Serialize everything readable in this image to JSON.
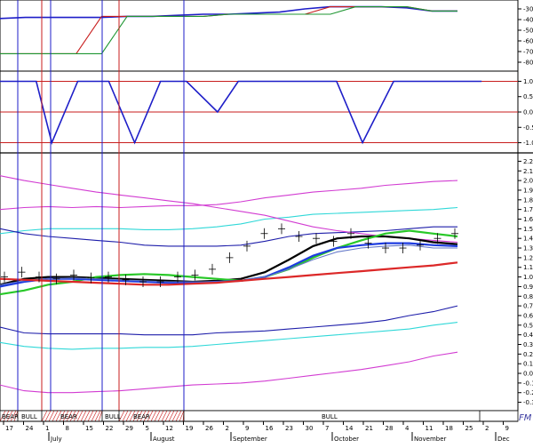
{
  "chart_data": [
    {
      "type": "line",
      "panel": "top-oscillator",
      "y_ticks": [
        "-30",
        "-40",
        "-50",
        "-60",
        "-70",
        "-80"
      ],
      "ylim": [
        -85,
        -25
      ],
      "x": [
        0,
        5,
        10,
        15,
        20,
        25,
        30,
        35,
        40,
        45,
        50,
        55,
        60,
        65,
        70,
        75,
        80,
        85,
        90
      ],
      "series": [
        {
          "color": "#1e1ec8",
          "values": [
            -39,
            -38,
            -38,
            -38,
            -38,
            -37,
            -37,
            -36,
            -35,
            -35,
            -34,
            -33,
            -30,
            -28,
            -28,
            -28,
            -29,
            -32,
            -32
          ]
        },
        {
          "color": "#c81e1e",
          "values": [
            -72,
            -72,
            -72,
            -72,
            -37,
            -37,
            -37,
            -37,
            -37,
            -35,
            -35,
            -35,
            -35,
            -28,
            -28,
            -28,
            -28,
            -32,
            -32
          ]
        },
        {
          "color": "#1e9632",
          "values": [
            -72,
            -72,
            -72,
            -72,
            -72,
            -37,
            -37,
            -37,
            -37,
            -35,
            -35,
            -35,
            -35,
            -35,
            -28,
            -28,
            -28,
            -32,
            -32
          ]
        }
      ]
    },
    {
      "type": "line",
      "panel": "signal",
      "y_ticks": [
        "1.0",
        "0.5",
        "0.0",
        "-0.5",
        "-1.0"
      ],
      "ylim": [
        -1.1,
        1.1
      ],
      "x": [
        0,
        7,
        10,
        15,
        21,
        26,
        31,
        36,
        42,
        46,
        50,
        53,
        57,
        60,
        65,
        70,
        76,
        80,
        84,
        89,
        93
      ],
      "series": [
        {
          "color": "#1e1ec8",
          "values": [
            1,
            1,
            -1,
            1,
            1,
            -1,
            1,
            1,
            0,
            1,
            1,
            1,
            1,
            1,
            1,
            -1,
            1,
            1,
            1,
            1,
            1
          ]
        }
      ]
    },
    {
      "type": "line",
      "panel": "price",
      "y_ticks": [
        "2.2",
        "2.1",
        "2.0",
        "1.9",
        "1.8",
        "1.7",
        "1.6",
        "1.5",
        "1.4",
        "1.3",
        "1.2",
        "1.1",
        "1.0",
        "0.9",
        "0.8",
        "0.7",
        "0.6",
        "0.5",
        "0.4",
        "0.3",
        "0.2",
        "0.1",
        "0.0",
        "-0.1",
        "-0.2",
        "-0.3"
      ],
      "ylim": [
        -0.35,
        2.25
      ],
      "x_labels": [
        "17",
        "24",
        "1",
        "8",
        "15",
        "22",
        "29",
        "5",
        "12",
        "19",
        "26",
        "2",
        "9",
        "16",
        "23",
        "30",
        "7",
        "14",
        "21",
        "28",
        "4",
        "11",
        "18",
        "25",
        "2",
        "9"
      ],
      "months": [
        "July",
        "August",
        "September",
        "October",
        "November",
        "Dec"
      ],
      "vertical_blue_at": [
        "20",
        "57",
        "115",
        "207"
      ],
      "vertical_red_at": [
        "47",
        "134"
      ],
      "band_labels": [
        "BEAR",
        "BULL",
        "BEAR",
        "BULL",
        "BEAR",
        "BULL"
      ],
      "series": [
        {
          "name": "",
          "color": "#d23cd2",
          "role": "upper-outer",
          "values": [
            1.7,
            1.72,
            1.73,
            1.72,
            1.73,
            1.72,
            1.73,
            1.74,
            1.74,
            1.75,
            1.78,
            1.82,
            1.85,
            1.88,
            1.9,
            1.92,
            1.95,
            1.97,
            1.99,
            2.0
          ]
        },
        {
          "name": "",
          "color": "#30d8d8",
          "role": "upper-mid",
          "values": [
            1.45,
            1.48,
            1.5,
            1.5,
            1.5,
            1.5,
            1.49,
            1.49,
            1.5,
            1.52,
            1.55,
            1.6,
            1.62,
            1.65,
            1.66,
            1.67,
            1.68,
            1.69,
            1.7,
            1.72
          ]
        },
        {
          "name": "",
          "color": "#1e1eaa",
          "role": "upper-inner",
          "values": [
            1.5,
            1.45,
            1.42,
            1.4,
            1.38,
            1.36,
            1.33,
            1.32,
            1.32,
            1.32,
            1.33,
            1.37,
            1.42,
            1.45,
            1.46,
            1.47,
            1.48,
            1.5,
            1.52,
            1.52
          ]
        },
        {
          "name": "",
          "color": "#d23cd2",
          "role": "trend",
          "values": [
            2.05,
            2.0,
            1.96,
            1.92,
            1.88,
            1.85,
            1.82,
            1.79,
            1.76,
            1.72,
            1.68,
            1.64,
            1.58,
            1.52,
            1.48,
            1.45,
            1.42,
            1.4,
            1.38,
            1.36
          ]
        },
        {
          "name": "",
          "color": "#000000",
          "role": "avg-black",
          "values": [
            0.92,
            0.98,
            1.0,
            1.0,
            0.99,
            0.98,
            0.97,
            0.96,
            0.95,
            0.96,
            0.98,
            1.05,
            1.18,
            1.32,
            1.4,
            1.42,
            1.42,
            1.4,
            1.36,
            1.34
          ]
        },
        {
          "name": "",
          "color": "#28c828",
          "role": "avg-green",
          "values": [
            0.82,
            0.86,
            0.92,
            0.95,
            1.0,
            1.02,
            1.03,
            1.02,
            1.0,
            0.98,
            0.96,
            1.0,
            1.08,
            1.2,
            1.3,
            1.38,
            1.45,
            1.48,
            1.45,
            1.42
          ]
        },
        {
          "name": "",
          "color": "#1e3ce0",
          "role": "avg-blue",
          "values": [
            0.9,
            0.95,
            0.98,
            0.98,
            0.97,
            0.96,
            0.95,
            0.94,
            0.94,
            0.95,
            0.96,
            1.0,
            1.1,
            1.22,
            1.3,
            1.33,
            1.35,
            1.35,
            1.33,
            1.32
          ]
        },
        {
          "name": "",
          "color": "#6478c8",
          "role": "avg-light",
          "values": [
            0.92,
            0.96,
            0.98,
            0.99,
            0.98,
            0.97,
            0.96,
            0.95,
            0.95,
            0.95,
            0.96,
            1.0,
            1.08,
            1.18,
            1.26,
            1.3,
            1.32,
            1.33,
            1.3,
            1.3
          ]
        },
        {
          "name": "",
          "color": "#dc2828",
          "role": "base-red",
          "values": [
            0.98,
            0.97,
            0.96,
            0.95,
            0.94,
            0.93,
            0.92,
            0.92,
            0.93,
            0.94,
            0.96,
            0.98,
            1.0,
            1.02,
            1.04,
            1.06,
            1.08,
            1.1,
            1.12,
            1.15
          ]
        },
        {
          "name": "",
          "color": "#1e1eaa",
          "role": "lower-inner",
          "values": [
            0.48,
            0.42,
            0.41,
            0.41,
            0.41,
            0.41,
            0.4,
            0.4,
            0.4,
            0.42,
            0.43,
            0.44,
            0.46,
            0.48,
            0.5,
            0.52,
            0.55,
            0.6,
            0.64,
            0.7
          ]
        },
        {
          "name": "",
          "color": "#30d8d8",
          "role": "lower-mid",
          "values": [
            0.32,
            0.28,
            0.26,
            0.25,
            0.26,
            0.26,
            0.27,
            0.27,
            0.28,
            0.3,
            0.32,
            0.34,
            0.36,
            0.38,
            0.4,
            0.42,
            0.44,
            0.46,
            0.5,
            0.53
          ]
        },
        {
          "name": "",
          "color": "#d23cd2",
          "role": "lower-outer",
          "values": [
            -0.12,
            -0.18,
            -0.2,
            -0.2,
            -0.19,
            -0.18,
            -0.16,
            -0.14,
            -0.12,
            -0.11,
            -0.1,
            -0.08,
            -0.05,
            -0.02,
            0.01,
            0.04,
            0.08,
            0.12,
            0.18,
            0.22
          ]
        }
      ],
      "price_bars": [
        1.0,
        1.05,
        1.0,
        0.98,
        1.02,
        0.99,
        1.0,
        0.97,
        0.95,
        0.95,
        1.0,
        1.02,
        1.08,
        1.2,
        1.32,
        1.45,
        1.5,
        1.42,
        1.4,
        1.37,
        1.45,
        1.35,
        1.3,
        1.3,
        1.33,
        1.4,
        1.45
      ]
    }
  ],
  "signature": "FM"
}
